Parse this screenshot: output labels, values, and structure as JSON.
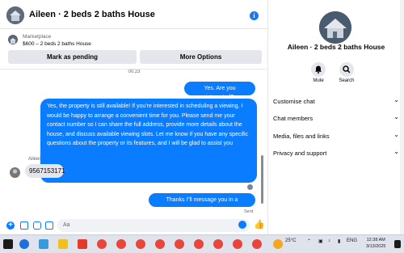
{
  "chat_header": {
    "title": "Aileen · 2 beds 2 baths House"
  },
  "marketplace": {
    "label": "Marketplace",
    "listing": "$600 – 2 beds 2 baths House",
    "mark_pending_label": "Mark as pending",
    "more_options_label": "More Options"
  },
  "messages": {
    "timestamp": "00:23",
    "out_1": "Yes. Are you interested?",
    "out_2": "Yes, the property is still available! If you're interested in scheduling a viewing, I would be happy to arrange a convenient time for you. Please send me your contact number so I can share the full address, provide more details about the house, and discuss available viewing slots. Let me know if you have any specific questions about the property or its features, and I will be glad to assist you",
    "sender_name": "Aileen",
    "in_1": "9567153171",
    "out_3": "Thanks i\"ll message you in a moment",
    "status": "Sent"
  },
  "composer": {
    "placeholder": "Aa"
  },
  "info_panel": {
    "name": "Aileen · 2 beds 2 baths House",
    "mute_label": "Mute",
    "search_label": "Search",
    "sections": [
      "Customise chat",
      "Chat members",
      "Media, files and links",
      "Privacy and support"
    ]
  },
  "taskbar": {
    "temperature": "25°C",
    "language": "ENG",
    "time": "12:38 AM",
    "date": "3/13/2025"
  },
  "colors": {
    "accent": "#0a7cff",
    "bubble_in": "#e4e6eb",
    "button_bg": "#e4e6eb"
  }
}
